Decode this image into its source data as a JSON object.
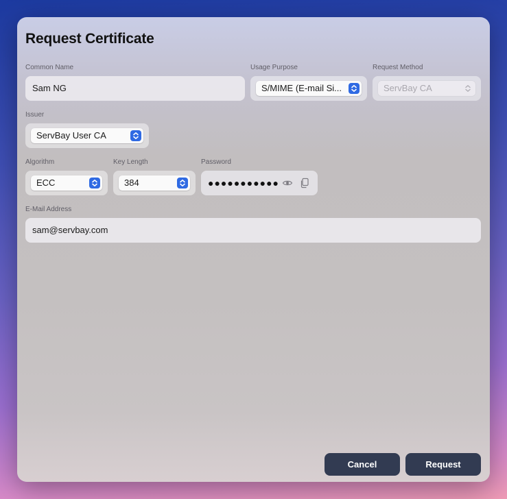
{
  "dialog": {
    "title": "Request Certificate"
  },
  "form": {
    "common_name": {
      "label": "Common Name",
      "value": "Sam NG"
    },
    "usage_purpose": {
      "label": "Usage Purpose",
      "value": "S/MIME (E-mail Si..."
    },
    "request_method": {
      "label": "Request Method",
      "value": "ServBay CA"
    },
    "issuer": {
      "label": "Issuer",
      "value": "ServBay User CA"
    },
    "algorithm": {
      "label": "Algorithm",
      "value": "ECC"
    },
    "key_length": {
      "label": "Key Length",
      "value": "384"
    },
    "password": {
      "label": "Password",
      "value": "●●●●●●●●●●●"
    },
    "email": {
      "label": "E-Mail Address",
      "value": "sam@servbay.com"
    }
  },
  "buttons": {
    "cancel": "Cancel",
    "request": "Request"
  },
  "icons": {
    "select_chevron": "up-down-chevron-icon",
    "show_password": "eye-icon",
    "copy_password": "copy-icon"
  },
  "colors": {
    "accent": "#2f6ae3",
    "button_bg": "#323b52"
  }
}
